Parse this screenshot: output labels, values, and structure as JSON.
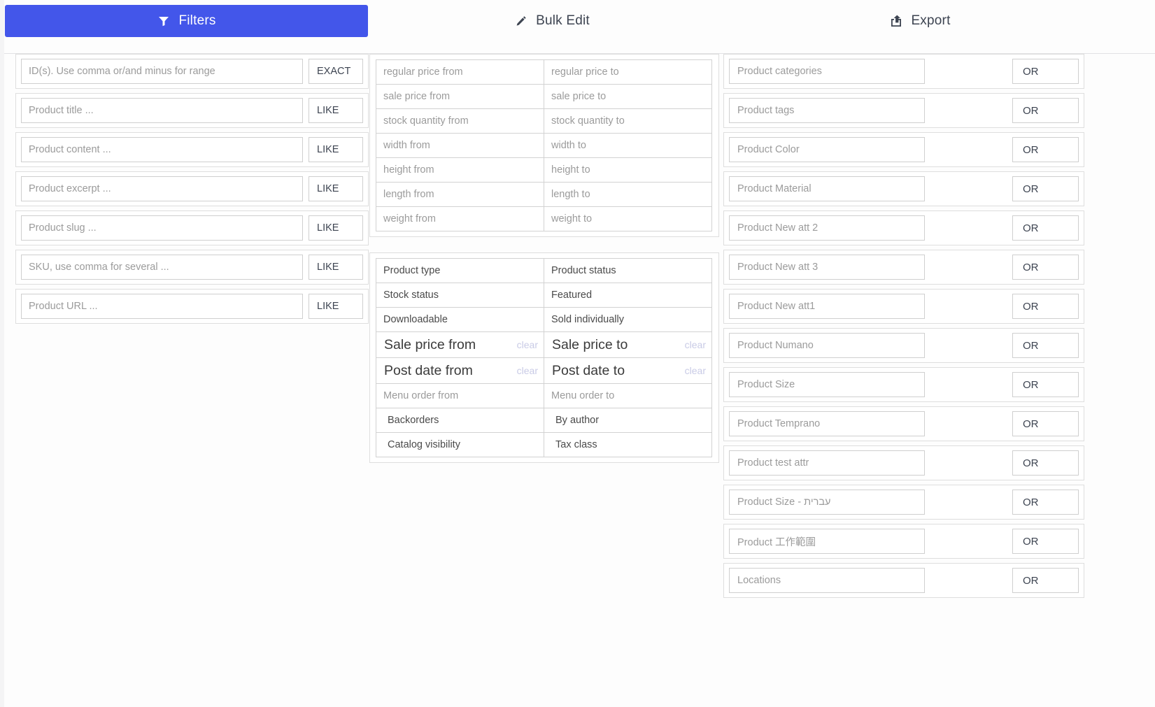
{
  "tabs": [
    {
      "id": "filters",
      "label": "Filters",
      "icon": "funnel-icon",
      "active": true
    },
    {
      "id": "bulk_edit",
      "label": "Bulk Edit",
      "icon": "pencil-icon",
      "active": false
    },
    {
      "id": "export",
      "label": "Export",
      "icon": "export-share-icon",
      "active": false
    }
  ],
  "colors": {
    "accent": "#4356ea",
    "page_background": "#f4f4f5",
    "panel_background": "#fdfdfd",
    "border": "#cfcfcf",
    "placeholder_text": "#9b9b9b",
    "label_text": "#3d4451",
    "clear_link": "#c9cbe6"
  },
  "left_column": {
    "rows": [
      {
        "placeholder": "ID(s). Use comma or/and minus for range",
        "operator": "EXACT"
      },
      {
        "placeholder": "Product title ...",
        "operator": "LIKE"
      },
      {
        "placeholder": "Product content ...",
        "operator": "LIKE"
      },
      {
        "placeholder": "Product excerpt ...",
        "operator": "LIKE"
      },
      {
        "placeholder": "Product slug ...",
        "operator": "LIKE"
      },
      {
        "placeholder": "SKU, use comma for several ...",
        "operator": "LIKE"
      },
      {
        "placeholder": "Product URL ...",
        "operator": "LIKE"
      }
    ]
  },
  "middle_column": {
    "numeric_group": [
      {
        "from": "regular price from",
        "to": "regular price to"
      },
      {
        "from": "sale price from",
        "to": "sale price to"
      },
      {
        "from": "stock quantity from",
        "to": "stock quantity to"
      },
      {
        "from": "width from",
        "to": "width to"
      },
      {
        "from": "height from",
        "to": "height to"
      },
      {
        "from": "length from",
        "to": "length to"
      },
      {
        "from": "weight from",
        "to": "weight to"
      }
    ],
    "select_group": [
      {
        "left": "Product type",
        "right": "Product status",
        "style": "select"
      },
      {
        "left": "Stock status",
        "right": "Featured",
        "style": "select"
      },
      {
        "left": "Downloadable",
        "right": "Sold individually",
        "style": "select"
      },
      {
        "left": "Sale price from",
        "right": "Sale price to",
        "style": "big",
        "clear_left": "clear",
        "clear_right": "clear"
      },
      {
        "left": "Post date from",
        "right": "Post date to",
        "style": "big",
        "clear_left": "clear",
        "clear_right": "clear"
      },
      {
        "left": "Menu order from",
        "right": "Menu order to",
        "style": "input"
      },
      {
        "left": "Backorders",
        "right": "By author",
        "style": "select2"
      },
      {
        "left": "Catalog visibility",
        "right": "Tax class",
        "style": "select2"
      }
    ]
  },
  "right_column": {
    "rows": [
      {
        "placeholder": "Product categories",
        "operator": "OR"
      },
      {
        "placeholder": "Product tags",
        "operator": "OR"
      },
      {
        "placeholder": "Product Color",
        "operator": "OR"
      },
      {
        "placeholder": "Product Material",
        "operator": "OR"
      },
      {
        "placeholder": "Product New att 2",
        "operator": "OR"
      },
      {
        "placeholder": "Product New att 3",
        "operator": "OR"
      },
      {
        "placeholder": "Product New att1",
        "operator": "OR"
      },
      {
        "placeholder": "Product Numano",
        "operator": "OR"
      },
      {
        "placeholder": "Product Size",
        "operator": "OR"
      },
      {
        "placeholder": "Product Temprano",
        "operator": "OR"
      },
      {
        "placeholder": "Product test attr",
        "operator": "OR"
      },
      {
        "placeholder": "Product Size - עברית",
        "operator": "OR"
      },
      {
        "placeholder": "Product 工作範圍",
        "operator": "OR"
      },
      {
        "placeholder": "Locations",
        "operator": "OR"
      }
    ]
  }
}
